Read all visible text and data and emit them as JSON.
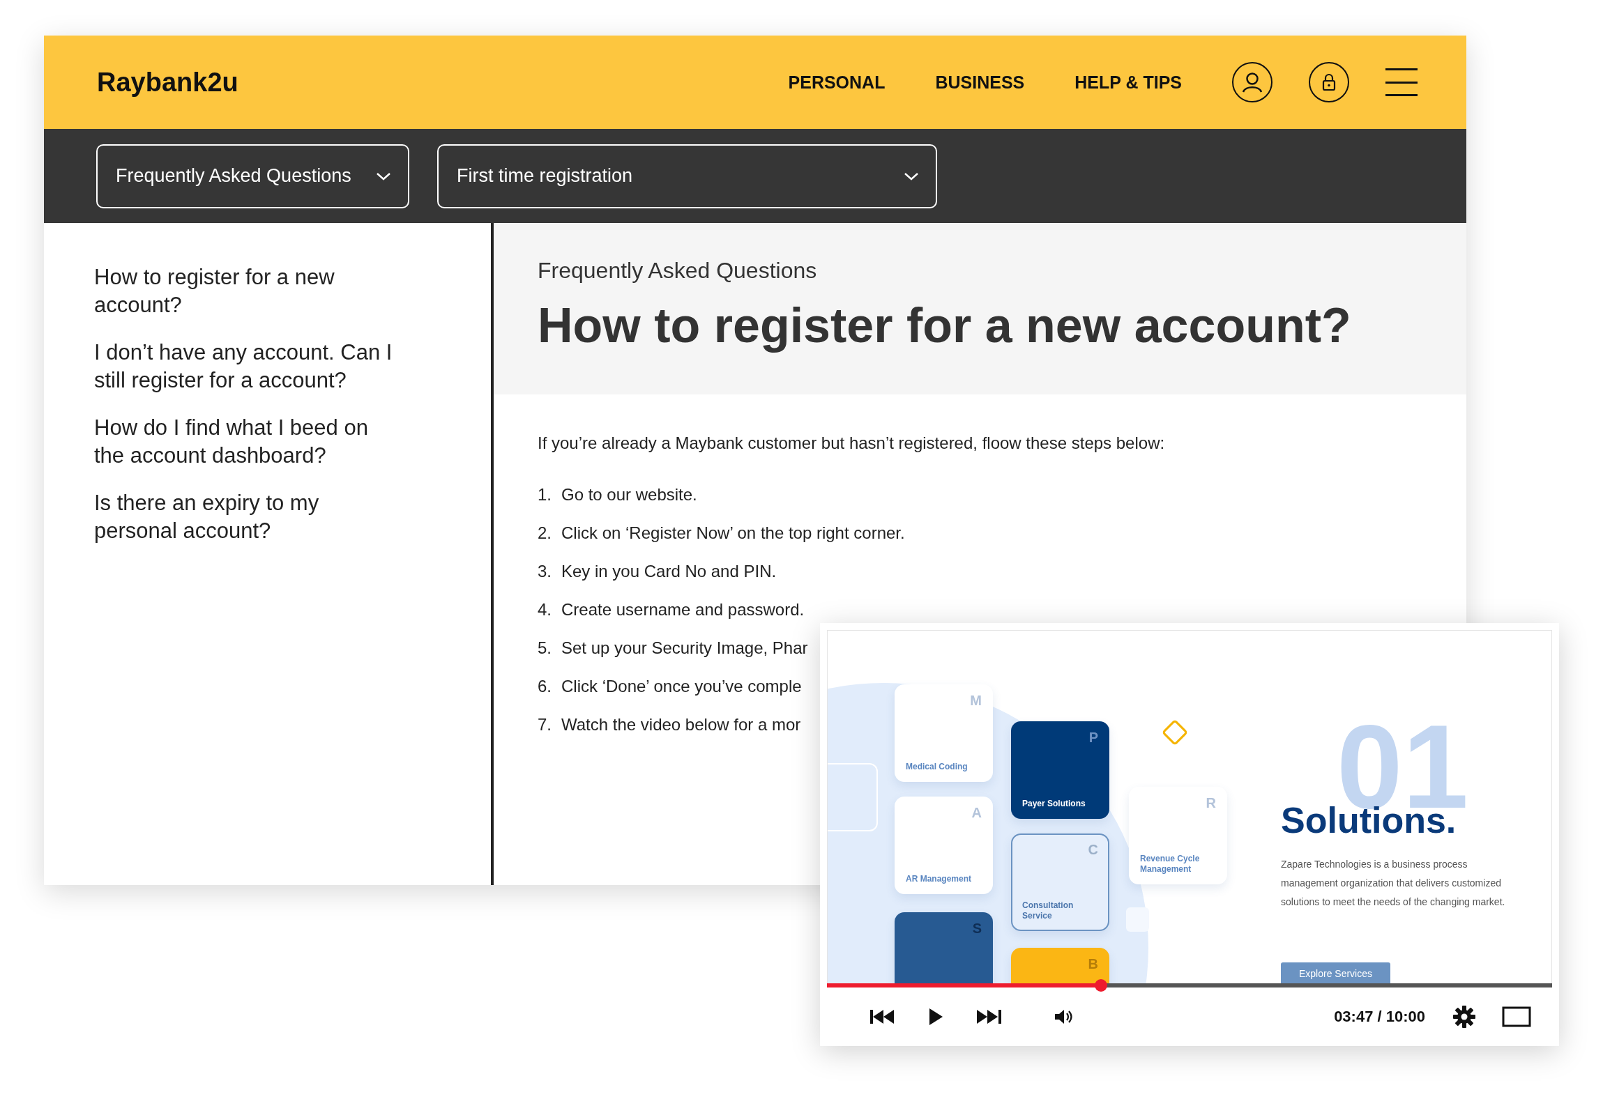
{
  "header": {
    "logo": "Raybank2u",
    "nav": [
      {
        "label": "PERSONAL"
      },
      {
        "label": "BUSINESS"
      },
      {
        "label": "HELP & TIPS"
      }
    ]
  },
  "filters": [
    {
      "value": "Frequently Asked Questions"
    },
    {
      "value": "First time registration"
    }
  ],
  "sidebar": {
    "items": [
      "How to register for a new account?",
      "I don’t have any account. Can I still register for a account?",
      "How do I find what I beed on the account dashboard?",
      "Is there an expiry to my personal account?"
    ]
  },
  "article": {
    "eyebrow": "Frequently Asked Questions",
    "title": "How to register for a new account?",
    "intro": "If you’re already a Maybank customer but hasn’t registered, floow these steps below:",
    "steps": [
      {
        "number": "1.",
        "text": "Go to our website."
      },
      {
        "number": "2.",
        "text": "Click on ‘Register Now’ on the top right corner."
      },
      {
        "number": "3.",
        "text": "Key in you Card No and PIN."
      },
      {
        "number": "4.",
        "text": "Create username and password."
      },
      {
        "number": "5.",
        "text": "Set up your Security Image, Phar"
      },
      {
        "number": "6.",
        "text": "Click ‘Done’ once you’ve comple"
      },
      {
        "number": "7.",
        "text": "Watch the video below for a mor"
      }
    ]
  },
  "video": {
    "slide": {
      "tiles": [
        {
          "kind": "light",
          "letter": "M",
          "label": "Medical Coding"
        },
        {
          "kind": "light",
          "letter": "A",
          "label": "AR Management"
        },
        {
          "kind": "dark",
          "letter": "S"
        },
        {
          "kind": "navy",
          "letter": "P",
          "label": "Payer Solutions"
        },
        {
          "kind": "outline",
          "letter": "C",
          "label": "Consultation Service"
        },
        {
          "kind": "yellow",
          "letter": "B"
        },
        {
          "kind": "light",
          "letter": "R",
          "label": "Revenue Cycle Management"
        }
      ],
      "big_number": "01",
      "heading": "Solutions.",
      "text": "Zapare Technologies is a business process management organization that delivers customized solutions to meet the needs of the changing market.",
      "button": "Explore Services"
    },
    "progress": {
      "level": 0.378
    },
    "time": "03:47 / 10:00"
  }
}
